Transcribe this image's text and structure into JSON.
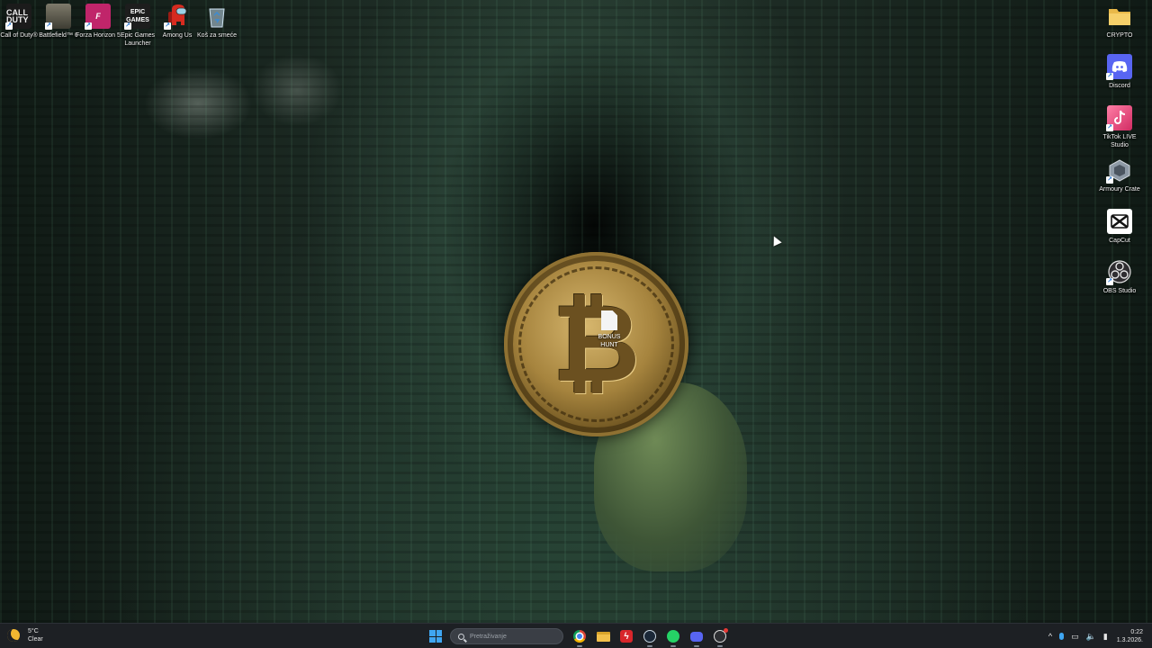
{
  "desktop": {
    "left_icons": [
      {
        "name": "call-of-duty",
        "label": "Call of Duty®",
        "glyph": "CALL DUTY"
      },
      {
        "name": "battlefield-6",
        "label": "Battlefield™ 6",
        "glyph": ""
      },
      {
        "name": "forza-horizon-5",
        "label": "Forza Horizon 5",
        "glyph": "F"
      },
      {
        "name": "epic-games-launcher",
        "label": "Epic Games Launcher",
        "glyph": "EPIC GAMES"
      },
      {
        "name": "among-us",
        "label": "Among Us",
        "glyph": ""
      },
      {
        "name": "recycle-bin",
        "label": "Koš za smeće",
        "glyph": ""
      }
    ],
    "right_icons": [
      {
        "name": "crypto-folder",
        "label": "CRYPTO"
      },
      {
        "name": "discord",
        "label": "Discord"
      },
      {
        "name": "tiktok-live-studio",
        "label": "TikTok LIVE Studio"
      },
      {
        "name": "armoury-crate",
        "label": "Armoury Crate"
      },
      {
        "name": "capcut",
        "label": "CapCut"
      },
      {
        "name": "obs-studio",
        "label": "OBS Studio"
      }
    ],
    "center_file": {
      "label": "BONUS HUNT"
    },
    "wallpaper": {
      "accent": "#1f3a2c",
      "coin_color": "#b8944b"
    }
  },
  "taskbar": {
    "weather": {
      "temp": "5°C",
      "condition": "Clear"
    },
    "search_placeholder": "Pretraživanje",
    "apps": [
      "windows-start",
      "chrome",
      "file-explorer",
      "red-app",
      "steam",
      "whatsapp",
      "discord",
      "obs-studio"
    ],
    "tray": {
      "chevron": "^",
      "time": "0:22",
      "date": "1.3.2026."
    },
    "accent": "#3fa6f2"
  }
}
